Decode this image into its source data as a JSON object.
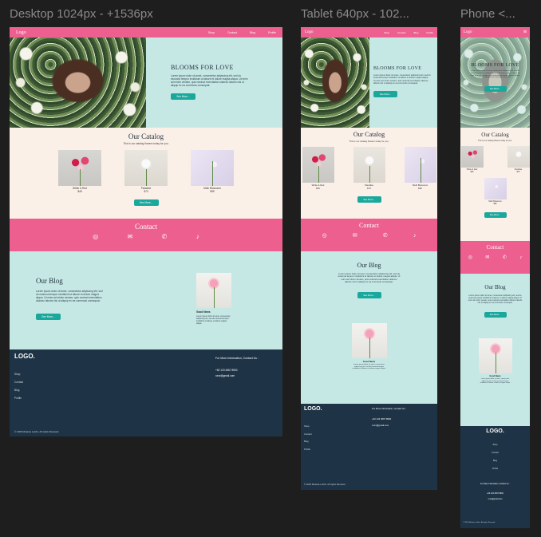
{
  "frames": {
    "desktop_label": "Desktop 1024px - +1536px",
    "tablet_label": "Tablet 640px - 102...",
    "phone_label": "Phone <..."
  },
  "nav": {
    "logo": "Logo",
    "links": [
      "Shop",
      "Contact",
      "Blog",
      "Profile"
    ]
  },
  "hero": {
    "title": "BLOOMS FOR LOVE",
    "body": "Lorem ipsum dolor sit amet, consectetur adipiscing elit, sed do eiusmod tempor incididunt ut labore et dolore magna aliqua. Ut enim ad minim veniam, quis nostrud exercitation ullamco laboris nisi ut aliquip ex ea commodo consequat.",
    "button": "See More..."
  },
  "catalog": {
    "title": "Our Catalog",
    "subtitle": "This is our catalog flowers today for you.",
    "items": [
      {
        "name": "White & Red",
        "price": "$45"
      },
      {
        "name": "Paradise",
        "price": "$73"
      },
      {
        "name": "Moth Blossoms",
        "price": "$95"
      }
    ],
    "button": "See More..."
  },
  "contact": {
    "title": "Contact",
    "icons": [
      "instagram-icon",
      "mail-icon",
      "phone-icon",
      "tiktok-icon"
    ]
  },
  "blog": {
    "title": "Our Blog",
    "body": "Lorem ipsum dolor sit amet, consectetur adipiscing elit, sed do eiusmod tempor incididunt ut labore et dolore magna aliqua. Ut enim ad minim veniam, quis nostrud exercitation ullamco laboris nisi ut aliquip ex ea commodo consequat.",
    "button": "See More...",
    "card_title": "Good News",
    "card_body": "Lorem ipsum dolor sit amet, consectetur adipiscing elit, sed do eiusmod tempor incididunt ut labore et dolore magna aliqua."
  },
  "footer": {
    "logo": "LOGO.",
    "links": [
      "Shop",
      "Contact",
      "Blog",
      "Profile"
    ],
    "info_title": "For More Information, Contact Us :",
    "phone": "+62 123 4567 8900",
    "email": "xxxx@gmail.com",
    "copyright": "© 2025 Melanie Leblin. All rights Reviewd"
  },
  "colors": {
    "pink": "#ec5f8f",
    "mint": "#c6e8e5",
    "cream": "#fbf0e8",
    "navy": "#1e3446",
    "teal": "#1aa89c"
  }
}
